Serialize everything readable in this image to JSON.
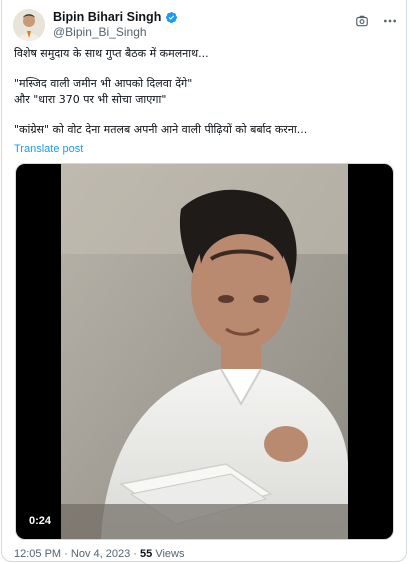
{
  "tweet": {
    "author_name": "Bipin Bihari Singh",
    "handle": "@Bipin_Bi_Singh",
    "lines": [
      "विशेष समुदाय के साथ गुप्त बैठक में कमलनाथ...",
      "\"मस्जिद वाली जमीन भी आपको दिलवा देंगे\"",
      "और \"धारा 370 पर भी सोचा जाएगा\"",
      "\"कांग्रेस\" को वोट देना मतलब अपनी आने वाली पीढ़ियों को बर्बाद करना..."
    ],
    "translate_label": "Translate post"
  },
  "media": {
    "duration": "0:24"
  },
  "meta": {
    "time": "12:05 PM",
    "separator": "·",
    "date": "Nov 4, 2023",
    "views_count": "55",
    "views_label": "Views"
  },
  "colors": {
    "link": "#1d9bf0",
    "verified": "#1d9bf0",
    "secondary_text": "#536471"
  },
  "icons": {
    "verified": "verified-badge-icon",
    "grok": "grok-icon",
    "more": "more-options-icon"
  }
}
